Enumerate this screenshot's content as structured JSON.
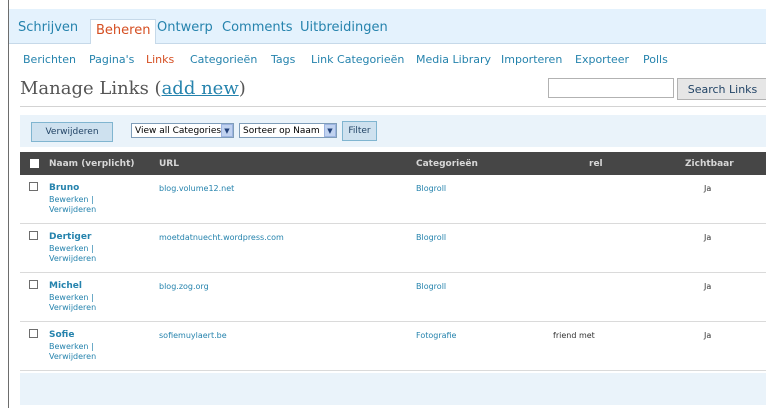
{
  "main_nav": {
    "tabs": [
      {
        "label": "Schrijven",
        "active": false
      },
      {
        "label": "Beheren",
        "active": true
      },
      {
        "label": "Ontwerp",
        "active": false
      },
      {
        "label": "Comments",
        "active": false
      },
      {
        "label": "Uitbreidingen",
        "active": false
      }
    ]
  },
  "sub_nav": {
    "items": [
      {
        "label": "Berichten",
        "active": false
      },
      {
        "label": "Pagina's",
        "active": false
      },
      {
        "label": "Links",
        "active": true
      },
      {
        "label": "Categorieën",
        "active": false
      },
      {
        "label": "Tags",
        "active": false
      },
      {
        "label": "Link Categorieën",
        "active": false
      },
      {
        "label": "Media Library",
        "active": false
      },
      {
        "label": "Importeren",
        "active": false
      },
      {
        "label": "Exporteer",
        "active": false
      },
      {
        "label": "Polls",
        "active": false
      }
    ]
  },
  "page": {
    "title_prefix": "Manage Links (",
    "title_link": "add new",
    "title_suffix": ")"
  },
  "search": {
    "value": "",
    "placeholder": "",
    "button_label": "Search Links"
  },
  "tablenav": {
    "delete_label": "Verwijderen",
    "category_select": "View all Categories",
    "sort_select": "Sorteer op Naam",
    "filter_label": "Filter"
  },
  "table": {
    "headers": {
      "name": "Naam (verplicht)",
      "url": "URL",
      "categories": "Categorieën",
      "rel": "rel",
      "visible": "Zichtbaar"
    },
    "row_actions": {
      "edit": "Bewerken |",
      "delete": "Verwijderen"
    },
    "rows": [
      {
        "name": "Bruno",
        "url": "blog.volume12.net",
        "category": "Blogroll",
        "rel": "",
        "visible": "Ja"
      },
      {
        "name": "Dertiger",
        "url": "moetdatnuecht.wordpress.com",
        "category": "Blogroll",
        "rel": "",
        "visible": "Ja"
      },
      {
        "name": "Michel",
        "url": "blog.zog.org",
        "category": "Blogroll",
        "rel": "",
        "visible": "Ja"
      },
      {
        "name": "Sofie",
        "url": "sofiemuylaert.be",
        "category": "Fotografie",
        "rel": "friend met",
        "visible": "Ja"
      }
    ]
  },
  "colors": {
    "link": "#2583ad",
    "active": "#d54e21",
    "nav_bg": "#e4f2fd",
    "header_bg": "#464646"
  }
}
